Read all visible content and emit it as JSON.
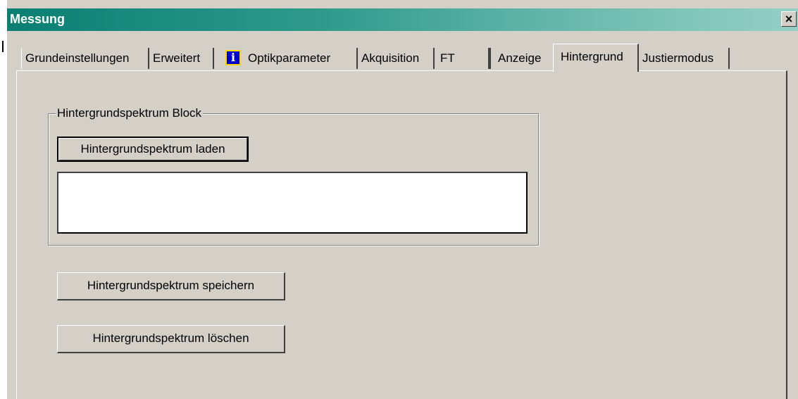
{
  "window": {
    "title": "Messung",
    "close_label": "×",
    "colors": {
      "titlebar_start": "#0a7f72",
      "titlebar_end": "#96cfc5",
      "face": "#d4d0c8"
    }
  },
  "tabs": [
    {
      "label": "Grundeinstellungen"
    },
    {
      "label": "Erweitert"
    },
    {
      "label": "Optikparameter",
      "icon": "info-icon",
      "icon_text": "i"
    },
    {
      "label": "Akquisition"
    },
    {
      "label": "FT"
    },
    {
      "label": "Anzeige"
    },
    {
      "label": "Hintergrund",
      "active": true
    },
    {
      "label": "Justiermodus"
    }
  ],
  "panel": {
    "group": {
      "label": "Hintergrundspektrum Block",
      "load_button": "Hintergrundspektrum laden"
    },
    "save_button": "Hintergrundspektrum speichern",
    "delete_button": "Hintergrundspektrum löschen"
  }
}
